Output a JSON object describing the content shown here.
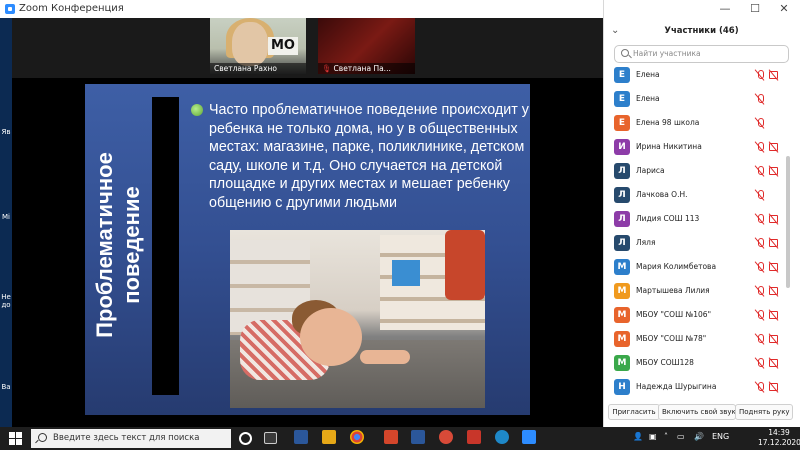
{
  "window": {
    "title": "Zoom Конференция"
  },
  "left_strip": {
    "labels": [
      "Яв",
      "Mi",
      "Не\nдо",
      "Ва"
    ]
  },
  "thumbnails": [
    {
      "name": "Светлана Рахно",
      "overlay_text": "МО",
      "muted": false
    },
    {
      "name": "Светлана Па...",
      "muted": true
    }
  ],
  "slide": {
    "vertical_title": "Проблематичное\nповедение",
    "bullet_text": "Часто проблематичное поведение происходит у ребенка не только дома, но у в общественных местах: магазине, парке, поликлинике, детском саду, школе и т.д. Оно случается на детской площадке и других местах и мешает ребенку общению с другими людьми"
  },
  "panel": {
    "title": "Участники (46)",
    "search_placeholder": "Найти участника",
    "participants": [
      {
        "initial": "Е",
        "name": "Елена",
        "color": "#2d7fcb",
        "mic_off": true,
        "cam_off": true
      },
      {
        "initial": "Е",
        "name": "Елена",
        "color": "#2d7fcb",
        "mic_off": true,
        "cam_off": false
      },
      {
        "initial": "Е",
        "name": "Елена 98 школа",
        "color": "#e8642c",
        "mic_off": true,
        "cam_off": false
      },
      {
        "initial": "И",
        "name": "Ирина Никитина",
        "color": "#8d3ca8",
        "mic_off": true,
        "cam_off": true
      },
      {
        "initial": "Л",
        "name": "Лариса",
        "color": "#274a6d",
        "mic_off": true,
        "cam_off": true
      },
      {
        "initial": "Л",
        "name": "Лачкова О.Н.",
        "color": "#274a6d",
        "mic_off": true,
        "cam_off": false
      },
      {
        "initial": "Л",
        "name": "Лидия СОШ 113",
        "color": "#8d3ca8",
        "mic_off": true,
        "cam_off": true
      },
      {
        "initial": "Л",
        "name": "Ляля",
        "color": "#274a6d",
        "mic_off": true,
        "cam_off": true
      },
      {
        "initial": "М",
        "name": "Мария Колимбетова",
        "color": "#2d7fcb",
        "mic_off": true,
        "cam_off": true
      },
      {
        "initial": "М",
        "name": "Мартышева Лилия",
        "color": "#f09a1e",
        "mic_off": true,
        "cam_off": true
      },
      {
        "initial": "М",
        "name": "МБОУ \"СОШ №106\"",
        "color": "#e8642c",
        "mic_off": true,
        "cam_off": true
      },
      {
        "initial": "М",
        "name": "МБОУ \"СОШ №78\"",
        "color": "#e8642c",
        "mic_off": true,
        "cam_off": true
      },
      {
        "initial": "М",
        "name": "МБОУ СОШ128",
        "color": "#3aa84a",
        "mic_off": true,
        "cam_off": true
      },
      {
        "initial": "Н",
        "name": "Надежда Шурыгина",
        "color": "#2d7fcb",
        "mic_off": true,
        "cam_off": true
      }
    ],
    "buttons": {
      "invite": "Пригласить",
      "unmute": "Включить свой звук",
      "raise_hand": "Поднять руку"
    }
  },
  "taskbar": {
    "search_placeholder": "Введите здесь текст для поиска",
    "language": "ENG",
    "time": "14:39",
    "date": "17.12.2020"
  }
}
